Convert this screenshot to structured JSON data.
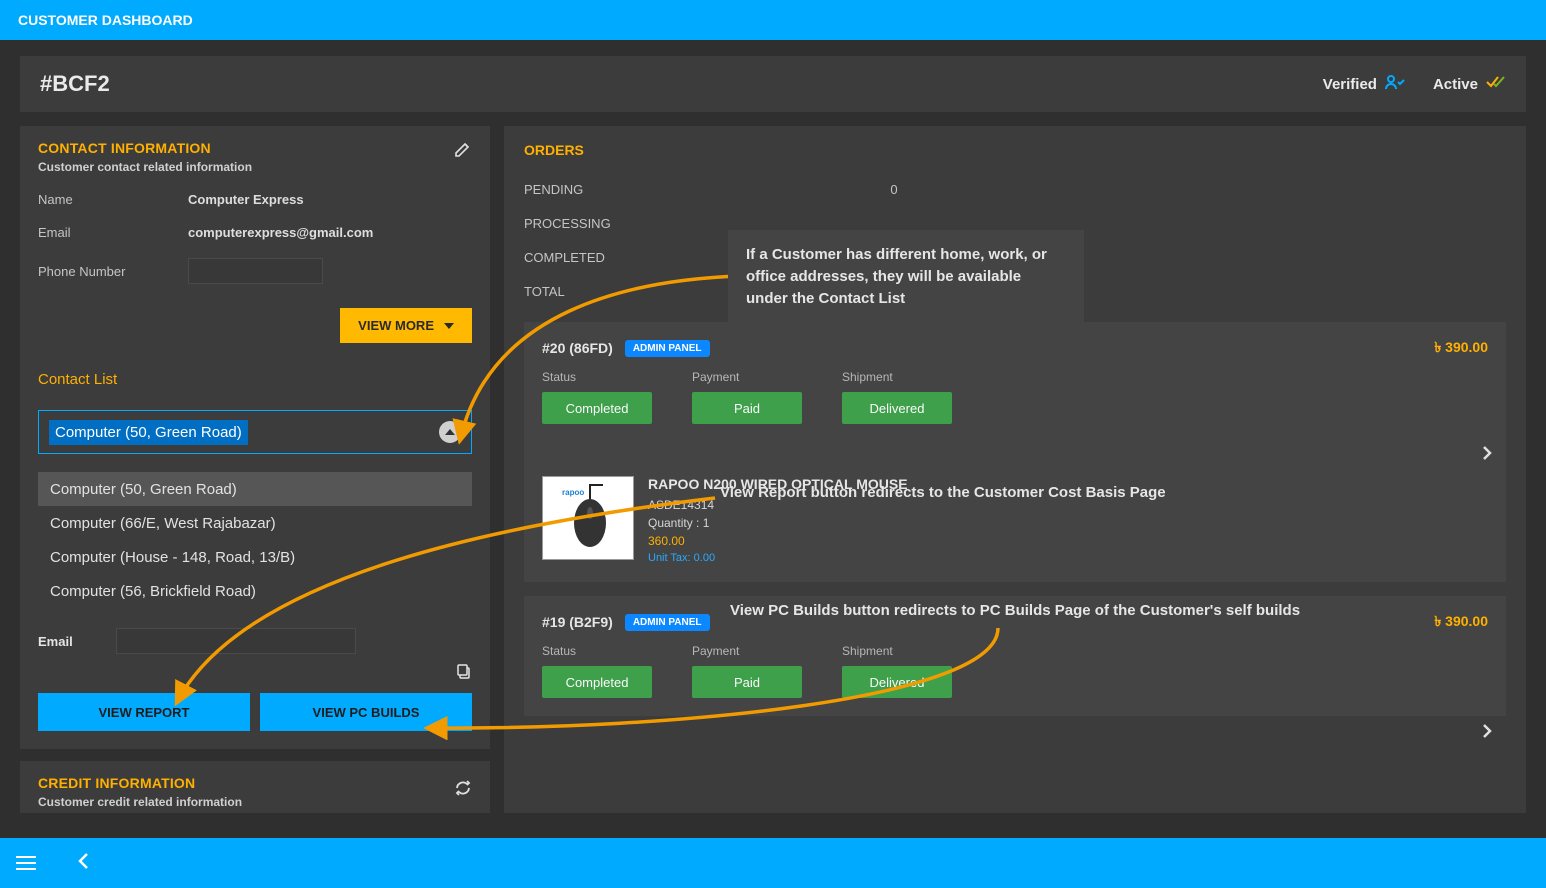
{
  "topbar": {
    "title": "CUSTOMER DASHBOARD"
  },
  "header": {
    "code": "#BCF2",
    "verified_label": "Verified",
    "active_label": "Active"
  },
  "contact_info": {
    "heading": "CONTACT INFORMATION",
    "subheading": "Customer contact related information",
    "name_label": "Name",
    "name_value": "Computer Express",
    "email_label": "Email",
    "email_value": "computerexpress@gmail.com",
    "phone_label": "Phone Number",
    "view_more_label": "VIEW MORE"
  },
  "contact_list": {
    "heading": "Contact List",
    "selected": "Computer (50, Green Road)",
    "options": [
      "Computer (50, Green Road)",
      "Computer (66/E, West Rajabazar)",
      "Computer (House - 148, Road, 13/B)",
      "Computer (56, Brickfield Road)"
    ],
    "email_label": "Email",
    "view_report_label": "VIEW REPORT",
    "view_pc_builds_label": "VIEW PC BUILDS"
  },
  "credit_info": {
    "heading": "CREDIT INFORMATION",
    "subheading": "Customer credit related information"
  },
  "orders": {
    "heading": "ORDERS",
    "stats": {
      "pending_label": "PENDING",
      "pending_value": "0",
      "processing_label": "PROCESSING",
      "completed_label": "COMPLETED",
      "total_label": "TOTAL"
    },
    "items": [
      {
        "title": "#20 (86FD)",
        "badge": "ADMIN PANEL",
        "price": "৳  390.00",
        "status_label": "Status",
        "status_value": "Completed",
        "payment_label": "Payment",
        "payment_value": "Paid",
        "shipment_label": "Shipment",
        "shipment_value": "Delivered",
        "product": {
          "name": "RAPOO N200 WIRED OPTICAL MOUSE",
          "sku": "ASDE14314",
          "quantity": "Quantity : 1",
          "price": "360.00",
          "tax": "Unit Tax: 0.00"
        }
      },
      {
        "title": "#19 (B2F9)",
        "badge": "ADMIN PANEL",
        "price": "৳  390.00",
        "status_label": "Status",
        "status_value": "Completed",
        "payment_label": "Payment",
        "payment_value": "Paid",
        "shipment_label": "Shipment",
        "shipment_value": "Delivered"
      }
    ]
  },
  "annotations": {
    "tip1": "If a Customer has different home, work, or office addresses, they will be available under the Contact List",
    "tip2": "View Report button redirects to the Customer Cost Basis Page",
    "tip3": "View PC Builds button redirects to PC Builds Page of the Customer's self builds"
  }
}
